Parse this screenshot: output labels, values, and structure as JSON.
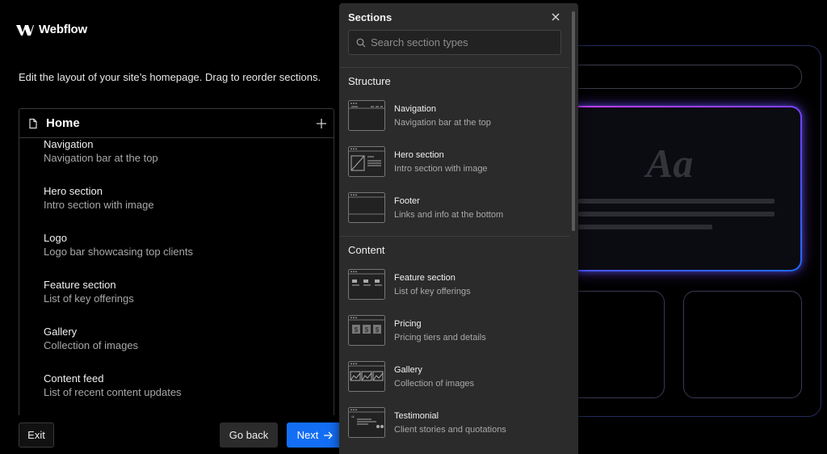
{
  "brand": {
    "name": "Webflow"
  },
  "intro": "Edit the layout of your site’s homepage. Drag to reorder sections.",
  "outline": {
    "title": "Home",
    "items": [
      {
        "name": "Navigation",
        "desc": "Navigation bar at the top"
      },
      {
        "name": "Hero section",
        "desc": "Intro section with image"
      },
      {
        "name": "Logo",
        "desc": "Logo bar showcasing top clients"
      },
      {
        "name": "Feature section",
        "desc": "List of key offerings"
      },
      {
        "name": "Gallery",
        "desc": "Collection of images"
      },
      {
        "name": "Content feed",
        "desc": "List of recent content updates"
      }
    ]
  },
  "buttons": {
    "exit": "Exit",
    "back": "Go back",
    "next": "Next"
  },
  "preview": {
    "glyph": "Aa"
  },
  "panel": {
    "title": "Sections",
    "search_placeholder": "Search section types",
    "groups": [
      {
        "title": "Structure",
        "items": [
          {
            "name": "Navigation",
            "desc": "Navigation bar at the top",
            "icon": "navigation-thumb-icon"
          },
          {
            "name": "Hero section",
            "desc": "Intro section with image",
            "icon": "hero-thumb-icon"
          },
          {
            "name": "Footer",
            "desc": "Links and info at the bottom",
            "icon": "footer-thumb-icon"
          }
        ]
      },
      {
        "title": "Content",
        "items": [
          {
            "name": "Feature section",
            "desc": "List of key offerings",
            "icon": "feature-thumb-icon"
          },
          {
            "name": "Pricing",
            "desc": "Pricing tiers and details",
            "icon": "pricing-thumb-icon"
          },
          {
            "name": "Gallery",
            "desc": "Collection of images",
            "icon": "gallery-thumb-icon"
          },
          {
            "name": "Testimonial",
            "desc": "Client stories and quotations",
            "icon": "testimonial-thumb-icon"
          }
        ]
      }
    ]
  },
  "colors": {
    "accent": "#146ef5",
    "panel_bg": "#2b2b2b",
    "background": "#000000"
  }
}
